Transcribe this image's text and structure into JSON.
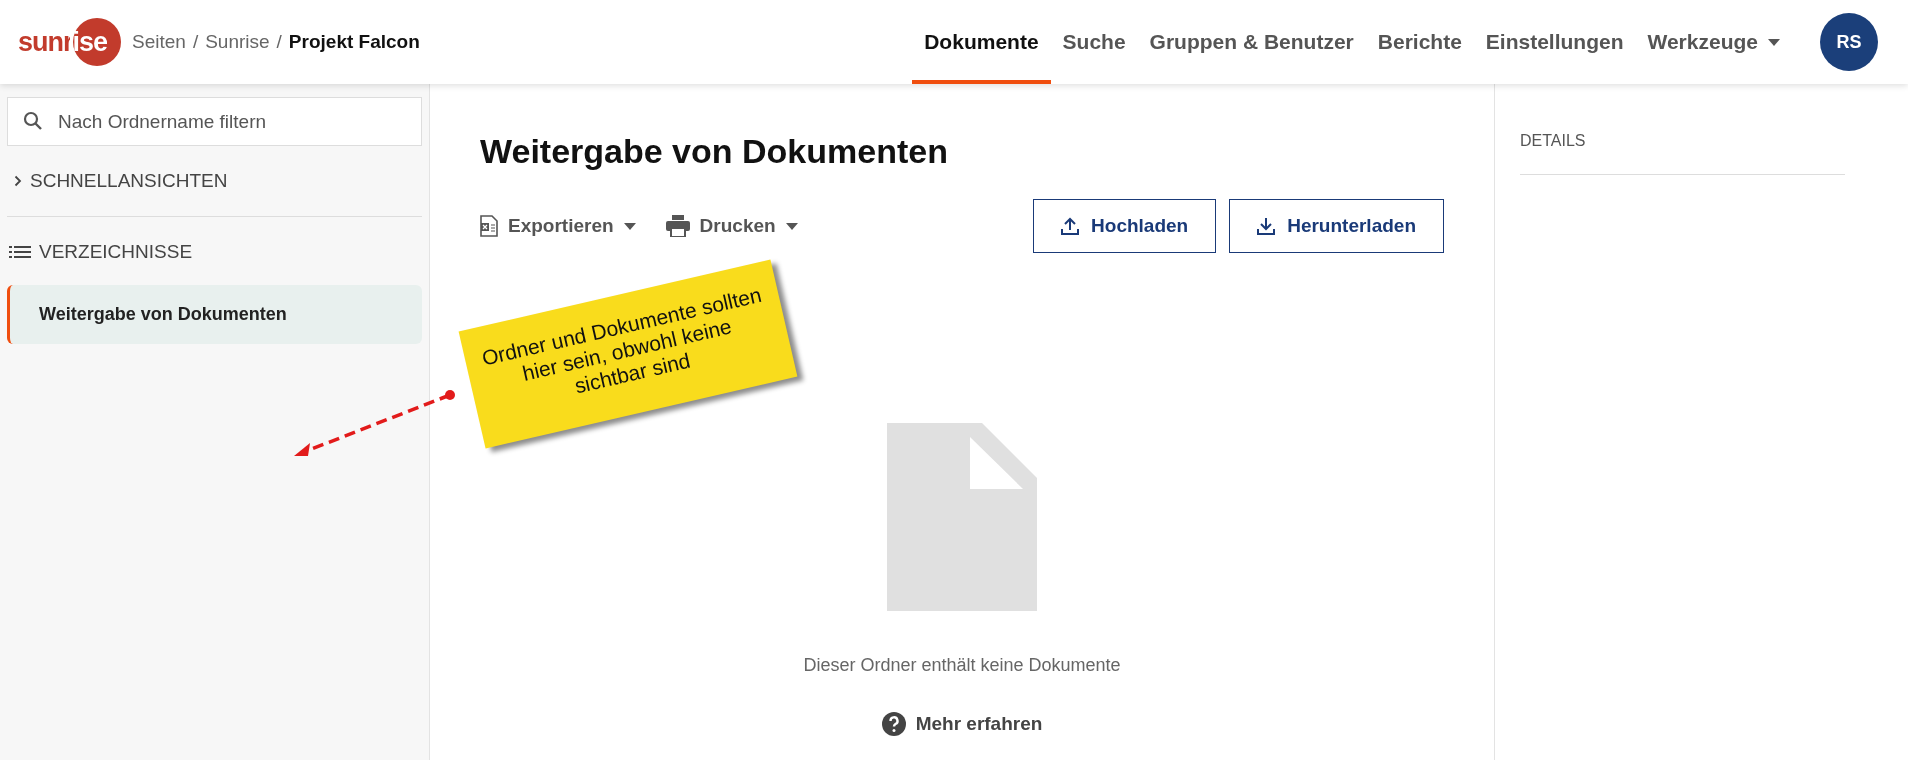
{
  "header": {
    "logo": "sunrise",
    "separator": "/",
    "breadcrumb": [
      {
        "label": "Seiten",
        "current": false
      },
      {
        "label": "Sunrise",
        "current": false
      },
      {
        "label": "Projekt Falcon",
        "current": true
      }
    ],
    "nav": [
      {
        "label": "Dokumente",
        "selected": true,
        "dropdown": false
      },
      {
        "label": "Suche",
        "selected": false,
        "dropdown": false
      },
      {
        "label": "Gruppen & Benutzer",
        "selected": false,
        "dropdown": false
      },
      {
        "label": "Berichte",
        "selected": false,
        "dropdown": false
      },
      {
        "label": "Einstellungen",
        "selected": false,
        "dropdown": false
      },
      {
        "label": "Werkzeuge",
        "selected": false,
        "dropdown": true
      }
    ],
    "avatar": "RS"
  },
  "sidebar": {
    "search": {
      "placeholder": "Nach Ordnername filtern"
    },
    "sections": [
      {
        "label": "SCHNELLANSICHTEN",
        "kind": "collapsed"
      },
      {
        "label": "VERZEICHNISSE",
        "kind": "list",
        "items": [
          {
            "label": "Weitergabe von Dokumenten",
            "selected": true
          }
        ]
      }
    ]
  },
  "main": {
    "title": "Weitergabe von Dokumenten",
    "tools": [
      {
        "label": "Exportieren",
        "kind": "excel"
      },
      {
        "label": "Drucken",
        "kind": "print"
      }
    ],
    "buttons": [
      {
        "label": "Hochladen",
        "kind": "upload"
      },
      {
        "label": "Herunterladen",
        "kind": "download"
      }
    ],
    "empty_message": "Dieser Ordner enthält keine Dokumente",
    "help_link": "Mehr erfahren"
  },
  "annotation": {
    "text": "Ordner und Dokumente sollten hier sein, obwohl keine sichtbar sind"
  },
  "details": {
    "title": "DETAILS"
  }
}
